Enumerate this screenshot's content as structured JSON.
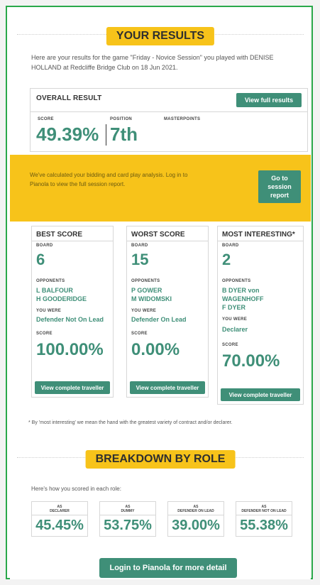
{
  "results_header": {
    "title": "YOUR RESULTS"
  },
  "intro": {
    "text": "Here are your results for the game \"Friday - Novice Session\" you played with DENISE HOLLAND at Redcliffe Bridge Club on 18 Jun 2021."
  },
  "overall": {
    "title": "OVERALL RESULT",
    "view_button": "View full results",
    "score_label": "SCORE",
    "position_label": "POSITION",
    "masterpoints_label": "MASTERPOINTS",
    "score": "49.39%",
    "position": "7th"
  },
  "banner": {
    "text": "We've calculated your bidding and card play analysis. Log in to Pianola to view the full session report.",
    "button": "Go to session report"
  },
  "cards": [
    {
      "title": "BEST SCORE",
      "board_label": "BOARD",
      "board": "6",
      "opponents_label": "OPPONENTS",
      "opponents": [
        "L BALFOUR",
        "H GOODERIDGE"
      ],
      "you_were_label": "YOU WERE",
      "you_were": "Defender Not On Lead",
      "score_label": "SCORE",
      "score": "100.00%",
      "button": "View complete traveller"
    },
    {
      "title": "WORST SCORE",
      "board_label": "BOARD",
      "board": "15",
      "opponents_label": "OPPONENTS",
      "opponents": [
        "P GOWER",
        "M WIDOMSKI"
      ],
      "you_were_label": "YOU WERE",
      "you_were": "Defender On Lead",
      "score_label": "SCORE",
      "score": "0.00%",
      "button": "View complete traveller"
    },
    {
      "title": "MOST INTERESTING*",
      "board_label": "BOARD",
      "board": "2",
      "opponents_label": "OPPONENTS",
      "opponents": [
        "B DYER von",
        "WAGENHOFF",
        "F DYER"
      ],
      "you_were_label": "YOU WERE",
      "you_were": "Declarer",
      "score_label": "SCORE",
      "score": "70.00%",
      "button": "View complete traveller"
    }
  ],
  "footnote": {
    "text": "* By 'most interesting' we mean the hand with the greatest variety of contract and/or declarer."
  },
  "breakdown_header": {
    "title": "BREAKDOWN BY ROLE"
  },
  "breakdown": {
    "intro": "Here's how you scored in each role:",
    "roles": [
      {
        "label_line1": "AS",
        "label_line2": "DECLARER",
        "value": "45.45%"
      },
      {
        "label_line1": "AS",
        "label_line2": "DUMMY",
        "value": "53.75%"
      },
      {
        "label_line1": "AS",
        "label_line2": "DEFENDER ON LEAD",
        "value": "39.00%"
      },
      {
        "label_line1": "AS",
        "label_line2": "DEFENDER NOT ON LEAD",
        "value": "55.38%"
      }
    ]
  },
  "login": {
    "button": "Login to Pianola for more detail"
  },
  "colors": {
    "accent_green": "#3f8f78",
    "yellow": "#f7c31a",
    "frame_green": "#2aa84a"
  }
}
